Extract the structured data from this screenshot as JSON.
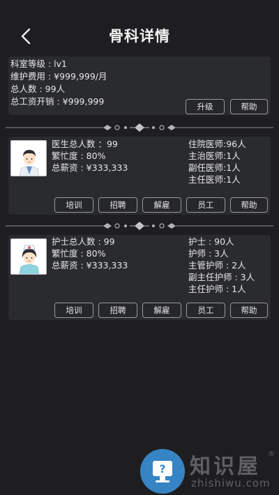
{
  "header": {
    "title": "骨科详情"
  },
  "department": {
    "level": "科室等级 : lv1",
    "maintenance": "维护费用 : ¥999,999/月",
    "total_people": "总人数 : 99人",
    "total_salary": "总工资开销 : ¥999,999",
    "upgrade_label": "升级",
    "help_label": "帮助"
  },
  "doctors": {
    "total": "医生总人数 ：99",
    "busy": "繁忙度 : 80%",
    "salary": "总薪资 : ¥333,333",
    "ranks": [
      "住院医师:96人",
      "主治医师:1人",
      "副任医师:1人",
      "主任医师:1人"
    ],
    "buttons": [
      "培训",
      "招聘",
      "解雇",
      "员工",
      "帮助"
    ]
  },
  "nurses": {
    "total": "护士总人数 : 99",
    "busy": "繁忙度 : 80%",
    "salary": "总薪资 : ¥333,333",
    "ranks": [
      "护士 : 90人",
      "护师 : 3人",
      "主管护师 : 2人",
      "副主任护师 : 3人",
      "主任护师 : 1人"
    ],
    "buttons": [
      "培训",
      "招聘",
      "解雇",
      "员工",
      "帮助"
    ]
  },
  "watermark": {
    "brand": "知识屋",
    "domain": "zhishiwu.com",
    "reg": "®"
  },
  "colors": {
    "background": "#1e1e21",
    "panel": "#2a2b2f",
    "button_border": "#9a9a9e",
    "watermark_blue": "#3a8fd6"
  }
}
